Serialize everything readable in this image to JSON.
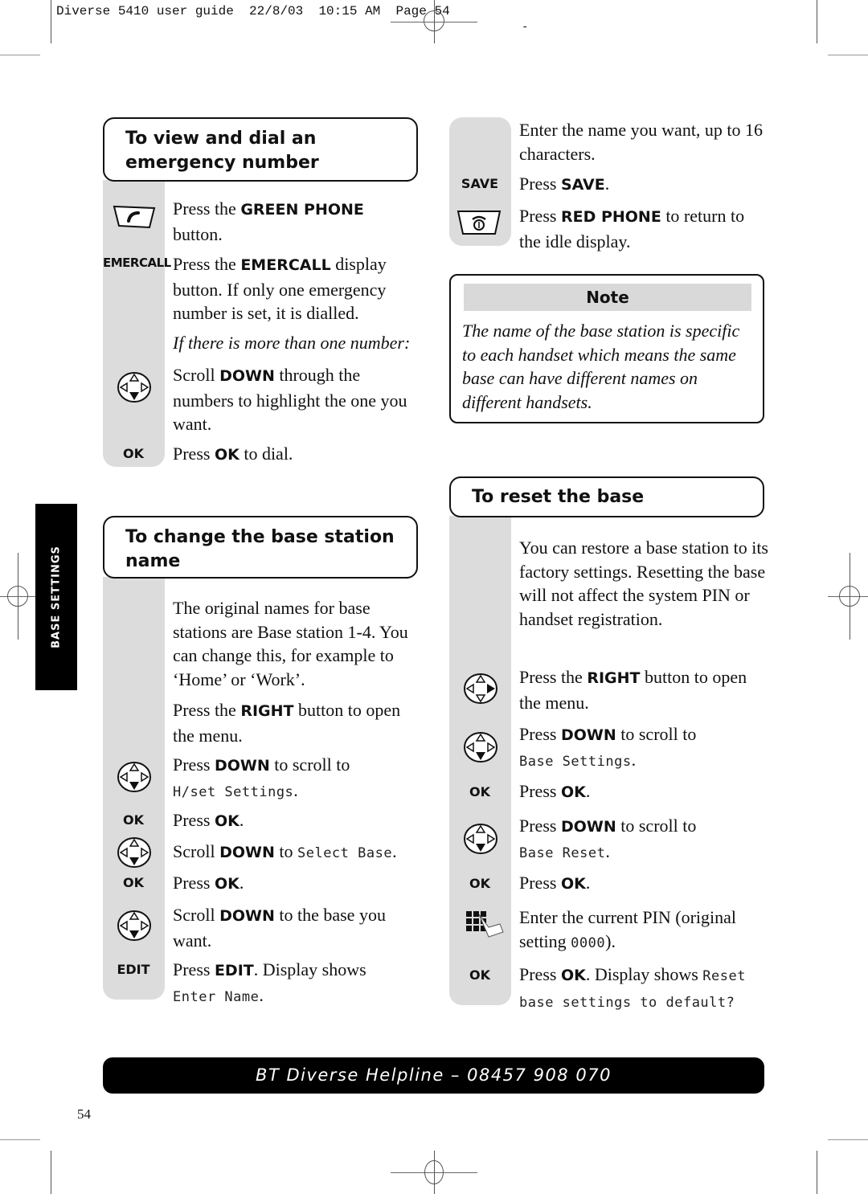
{
  "slug": {
    "text": "Diverse 5410 user guide  22/8/03  10:15 AM  Page 54",
    "dash": "-"
  },
  "side_tab": {
    "label": "BASE SETTINGS"
  },
  "section_emergency": {
    "title": "To view and dial an emergency number",
    "steps": [
      {
        "icon": "green-phone-icon",
        "pre": "Press the ",
        "bold": "GREEN PHONE",
        "post": " button."
      },
      {
        "icon_label": "EMERCALL",
        "pre": "Press the ",
        "bold": "EMERCALL",
        "post": " display button. If only one emergency number is set, it is dialled."
      },
      {
        "italic": "If there is more than one number:"
      },
      {
        "icon": "navigation-down-icon",
        "pre": "Scroll ",
        "bold": "DOWN",
        "post": " through the numbers to highlight the one you want."
      },
      {
        "icon_label": "OK",
        "pre": "Press ",
        "bold": "OK",
        "post": " to dial."
      }
    ]
  },
  "section_change_name": {
    "title": "To change the base station name",
    "steps": [
      {
        "text": "The original names for base stations are Base station 1-4. You can change this, for example to ‘Home’ or ‘Work’."
      },
      {
        "pre": "Press the ",
        "bold": "RIGHT",
        "post": " button to open the menu."
      },
      {
        "icon": "navigation-down-icon",
        "pre": "Press ",
        "bold": "DOWN",
        "post": " to scroll to ",
        "lcd": "H/set Settings",
        "end": "."
      },
      {
        "icon_label": "OK",
        "pre": "Press ",
        "bold": "OK",
        "post": "."
      },
      {
        "icon": "navigation-down-icon",
        "pre": "Scroll ",
        "bold": "DOWN",
        "post": " to ",
        "lcd": "Select Base",
        "end": "."
      },
      {
        "icon_label": "OK",
        "pre": "Press ",
        "bold": "OK",
        "post": "."
      },
      {
        "icon": "navigation-down-icon",
        "pre": "Scroll ",
        "bold": "DOWN",
        "post": " to the base you want."
      },
      {
        "icon_label": "EDIT",
        "pre": "Press ",
        "bold": "EDIT",
        "post": ". Display shows ",
        "lcd": "Enter Name",
        "end": "."
      }
    ],
    "continued": [
      {
        "text": "Enter the name you want, up to 16 characters."
      },
      {
        "icon_label": "SAVE",
        "pre": "Press ",
        "bold": "SAVE",
        "post": "."
      },
      {
        "icon": "red-phone-icon",
        "pre": "Press ",
        "bold": "RED PHONE",
        "post": " to return to the idle display."
      }
    ]
  },
  "note": {
    "title": "Note",
    "body": "The name of the base station is specific to each handset which means the same base can have different names on different handsets."
  },
  "section_reset": {
    "title": "To reset the base",
    "steps": [
      {
        "text": "You can restore a base station to its factory settings. Resetting the base will not affect the system PIN or handset registration."
      },
      {
        "icon": "navigation-right-icon",
        "pre": "Press the ",
        "bold": "RIGHT",
        "post": " button to open the menu."
      },
      {
        "icon": "navigation-down-icon",
        "pre": "Press ",
        "bold": "DOWN",
        "post": " to scroll to ",
        "lcd": "Base Settings",
        "end": "."
      },
      {
        "icon_label": "OK",
        "pre": "Press ",
        "bold": "OK",
        "post": "."
      },
      {
        "icon": "navigation-down-icon",
        "pre": "Press ",
        "bold": "DOWN",
        "post": " to scroll to ",
        "lcd": "Base Reset",
        "end": "."
      },
      {
        "icon_label": "OK",
        "pre": "Press ",
        "bold": "OK",
        "post": "."
      },
      {
        "icon": "keypad-icon",
        "pre": "Enter the current PIN (original setting ",
        "lcd": "0000",
        "end": ")."
      },
      {
        "icon_label": "OK",
        "pre": "Press ",
        "bold": "OK",
        "post": ". Display shows ",
        "lcd": "Reset base settings to default?"
      }
    ]
  },
  "footer": {
    "helpline": "BT Diverse Helpline – 08457 908 070",
    "page_number": "54"
  }
}
